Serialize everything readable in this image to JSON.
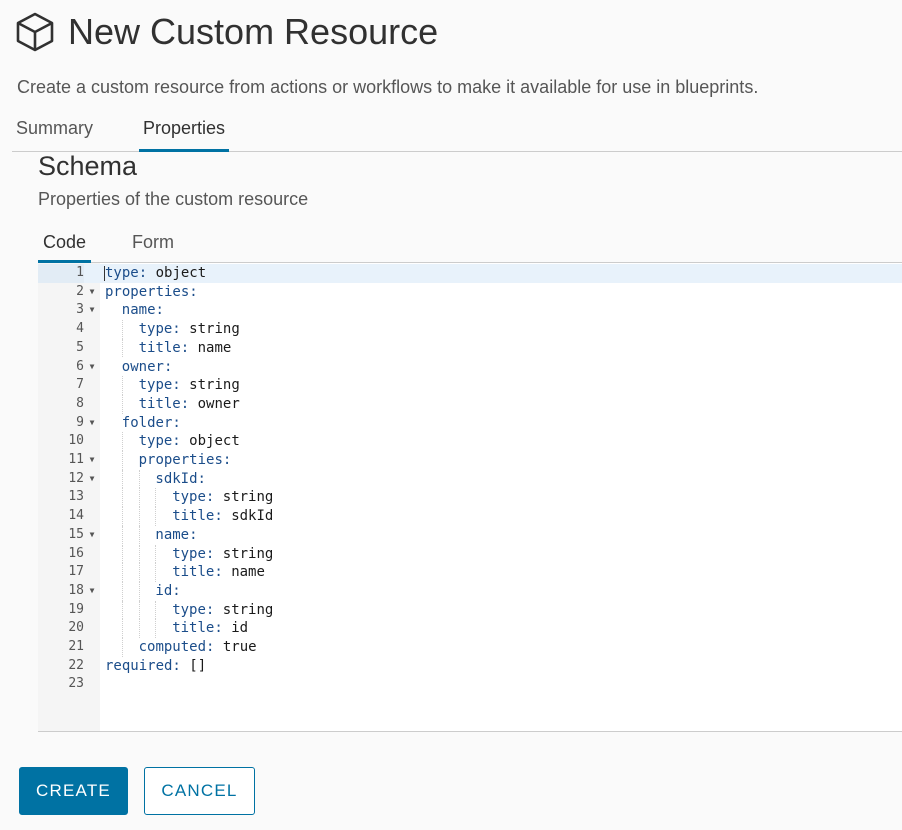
{
  "header": {
    "title": "New Custom Resource",
    "subtitle": "Create a custom resource from actions or workflows to make it available for use in blueprints.",
    "icon": "cube-icon"
  },
  "tabs": [
    {
      "label": "Summary",
      "active": false
    },
    {
      "label": "Properties",
      "active": true
    }
  ],
  "schema": {
    "title": "Schema",
    "subtitle": "Properties of the custom resource",
    "subtabs": [
      {
        "label": "Code",
        "active": true
      },
      {
        "label": "Form",
        "active": false
      }
    ]
  },
  "editor": {
    "current_line": 1,
    "lines": [
      {
        "n": "1",
        "key": "type:",
        "val": " object",
        "indent": 0,
        "fold": false
      },
      {
        "n": "2",
        "key": "properties:",
        "val": "",
        "indent": 0,
        "fold": true
      },
      {
        "n": "3",
        "key": "name:",
        "val": "",
        "indent": 1,
        "fold": true
      },
      {
        "n": "4",
        "key": "type:",
        "val": " string",
        "indent": 2,
        "fold": false
      },
      {
        "n": "5",
        "key": "title:",
        "val": " name",
        "indent": 2,
        "fold": false
      },
      {
        "n": "6",
        "key": "owner:",
        "val": "",
        "indent": 1,
        "fold": true
      },
      {
        "n": "7",
        "key": "type:",
        "val": " string",
        "indent": 2,
        "fold": false
      },
      {
        "n": "8",
        "key": "title:",
        "val": " owner",
        "indent": 2,
        "fold": false
      },
      {
        "n": "9",
        "key": "folder:",
        "val": "",
        "indent": 1,
        "fold": true
      },
      {
        "n": "10",
        "key": "type:",
        "val": " object",
        "indent": 2,
        "fold": false
      },
      {
        "n": "11",
        "key": "properties:",
        "val": "",
        "indent": 2,
        "fold": true
      },
      {
        "n": "12",
        "key": "sdkId:",
        "val": "",
        "indent": 3,
        "fold": true
      },
      {
        "n": "13",
        "key": "type:",
        "val": " string",
        "indent": 4,
        "fold": false
      },
      {
        "n": "14",
        "key": "title:",
        "val": " sdkId",
        "indent": 4,
        "fold": false
      },
      {
        "n": "15",
        "key": "name:",
        "val": "",
        "indent": 3,
        "fold": true
      },
      {
        "n": "16",
        "key": "type:",
        "val": " string",
        "indent": 4,
        "fold": false
      },
      {
        "n": "17",
        "key": "title:",
        "val": " name",
        "indent": 4,
        "fold": false
      },
      {
        "n": "18",
        "key": "id:",
        "val": "",
        "indent": 3,
        "fold": true
      },
      {
        "n": "19",
        "key": "type:",
        "val": " string",
        "indent": 4,
        "fold": false
      },
      {
        "n": "20",
        "key": "title:",
        "val": " id",
        "indent": 4,
        "fold": false
      },
      {
        "n": "21",
        "key": "computed:",
        "val": " true",
        "indent": 2,
        "fold": false
      },
      {
        "n": "22",
        "key": "required:",
        "val": " []",
        "indent": 0,
        "fold": false
      },
      {
        "n": "23",
        "key": "",
        "val": "",
        "indent": 0,
        "fold": false
      }
    ]
  },
  "actions": {
    "create_label": "CREATE",
    "cancel_label": "CANCEL"
  },
  "colors": {
    "accent": "#0072a3",
    "background": "#fafafa"
  }
}
